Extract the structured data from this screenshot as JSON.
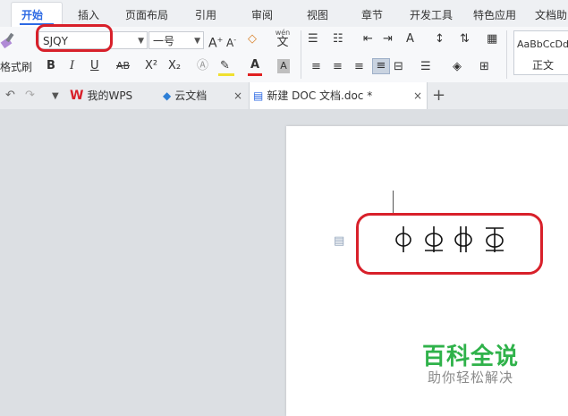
{
  "ribbon_tabs": [
    "开始",
    "插入",
    "页面布局",
    "引用",
    "审阅",
    "视图",
    "章节",
    "开发工具",
    "特色应用",
    "文档助"
  ],
  "ribbon": {
    "format_painter_label": "格式刷",
    "font_name": "SJQY",
    "font_size": "一号",
    "bold": "B",
    "italic": "I",
    "underline": "U",
    "strike": "AB",
    "superscript": "X²",
    "subscript": "X₂",
    "font_color_letter": "A",
    "phonetic_label": "wén",
    "phonetic_char": "文",
    "style_preview": "AaBbCcDd",
    "style_name": "正文"
  },
  "doc_tabs": {
    "wps": "我的WPS",
    "cloud": "云文档",
    "current": "新建 DOC 文档.doc *",
    "add": "+",
    "close": "×"
  },
  "document": {
    "symbols": [
      "ф",
      "ф",
      "ф",
      "ф"
    ]
  },
  "watermark": {
    "title": "百科全说",
    "subtitle": "助你轻松解决"
  },
  "colors": {
    "accent": "#2d6ae3",
    "highlight_box": "#d8202a",
    "watermark": "#2fb24a"
  }
}
